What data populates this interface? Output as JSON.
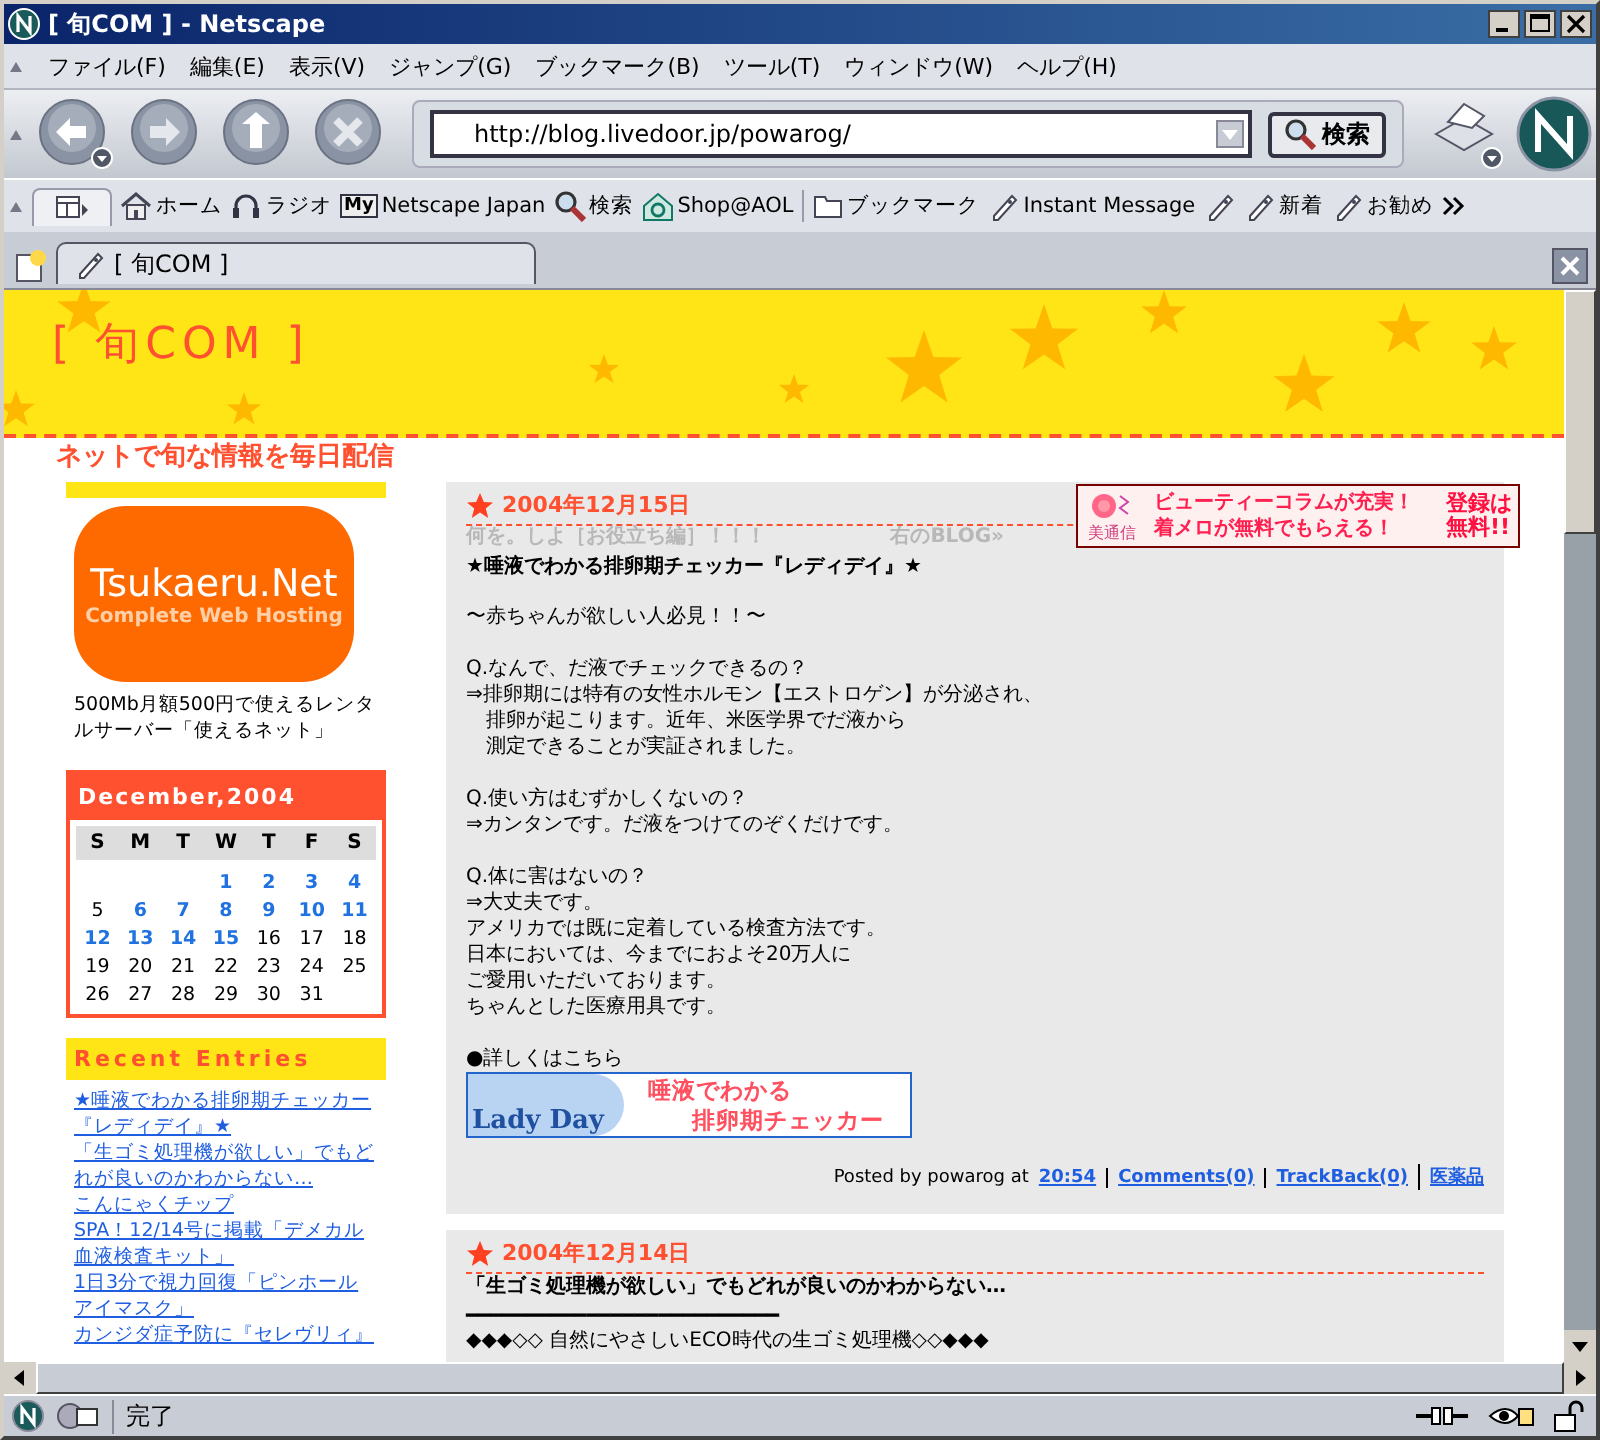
{
  "window": {
    "title": "[ 旬COM ] - Netscape"
  },
  "menu": [
    "ファイル(F)",
    "編集(E)",
    "表示(V)",
    "ジャンプ(G)",
    "ブックマーク(B)",
    "ツール(T)",
    "ウィンドウ(W)",
    "ヘルプ(H)"
  ],
  "address": {
    "value": "http://blog.livedoor.jp/powarog/",
    "search_button": "検索"
  },
  "personal_toolbar": [
    {
      "kind": "home",
      "label": "ホーム"
    },
    {
      "kind": "radio",
      "label": "ラジオ"
    },
    {
      "kind": "my",
      "badge": "My",
      "label": "Netscape Japan"
    },
    {
      "kind": "search",
      "label": "検索"
    },
    {
      "kind": "shop",
      "label": "Shop@AOL"
    },
    {
      "kind": "folder",
      "label": "ブックマーク"
    },
    {
      "kind": "bookmark",
      "label": "Instant Message"
    },
    {
      "kind": "bookmark"
    },
    {
      "kind": "bookmark",
      "label": "新着"
    },
    {
      "kind": "bookmark",
      "label": "お勧め"
    }
  ],
  "tab": {
    "title": "[ 旬COM ]"
  },
  "blog": {
    "title": "[ 旬COM ]",
    "tagline": "ネットで旬な情報を毎日配信"
  },
  "sidebar": {
    "ad": {
      "logo": "Tsukaeru.Net",
      "logo_tagline": "Complete Web Hosting",
      "caption": "500Mb月額500円で使えるレンタルサーバー「使えるネット」"
    },
    "calendar": {
      "title": "December,2004",
      "weekdays": [
        "S",
        "M",
        "T",
        "W",
        "T",
        "F",
        "S"
      ],
      "weeks": [
        [
          {
            "day": "1",
            "linked": true
          },
          {
            "day": "2",
            "linked": true
          },
          {
            "day": "3",
            "linked": true
          },
          {
            "day": "4",
            "linked": true
          }
        ],
        [
          {
            "day": "5",
            "linked": false
          },
          {
            "day": "6",
            "linked": true
          },
          {
            "day": "7",
            "linked": true
          },
          {
            "day": "8",
            "linked": true
          },
          {
            "day": "9",
            "linked": true
          },
          {
            "day": "10",
            "linked": true
          },
          {
            "day": "11",
            "linked": true
          }
        ],
        [
          {
            "day": "12",
            "linked": true
          },
          {
            "day": "13",
            "linked": true
          },
          {
            "day": "14",
            "linked": true
          },
          {
            "day": "15",
            "linked": true
          },
          {
            "day": "16",
            "linked": false
          },
          {
            "day": "17",
            "linked": false
          },
          {
            "day": "18",
            "linked": false
          }
        ],
        [
          {
            "day": "19",
            "linked": false
          },
          {
            "day": "20",
            "linked": false
          },
          {
            "day": "21",
            "linked": false
          },
          {
            "day": "22",
            "linked": false
          },
          {
            "day": "23",
            "linked": false
          },
          {
            "day": "24",
            "linked": false
          },
          {
            "day": "25",
            "linked": false
          }
        ],
        [
          {
            "day": "26",
            "linked": false
          },
          {
            "day": "27",
            "linked": false
          },
          {
            "day": "28",
            "linked": false
          },
          {
            "day": "29",
            "linked": false
          },
          {
            "day": "30",
            "linked": false
          },
          {
            "day": "31",
            "linked": false
          }
        ]
      ]
    },
    "recent_entries": {
      "title": "Recent Entries",
      "items": [
        "★唾液でわかる排卵期チェッカー『レディデイ』★",
        "「生ゴミ処理機が欲しい」でもどれが良いのかわからない…",
        "こんにゃくチップ",
        "SPA！12/14号に掲載「デメカル血液検査キット」",
        "1日3分で視力回復「ピンホールアイマスク」",
        "カンジダ症予防に『セレヴリィ』"
      ]
    }
  },
  "ad_banner": {
    "brand": "美通信",
    "line_1": "ビューティーコラムが充実！",
    "line_2": "着メロが無料でもらえる！",
    "badge_1": "登録は",
    "badge_2": "無料!!"
  },
  "posts": [
    {
      "date": "2004年12月15日",
      "ticker_left": "何を。しよ［お役立ち編］！！！",
      "ticker_right": "右のBLOG»",
      "title": "★唾液でわかる排卵期チェッカー『レディデイ』★",
      "paragraphs": [
        [
          "〜赤ちゃんが欲しい人必見！！〜"
        ],
        [
          "Q.なんで、だ液でチェックできるの？",
          "⇒排卵期には特有の女性ホルモン【エストロゲン】が分泌され、",
          "　排卵が起こります。近年、米医学界でだ液から",
          "　測定できることが実証されました。"
        ],
        [
          "Q.使い方はむずかしくないの？",
          "⇒カンタンです。だ液をつけてのぞくだけです。"
        ],
        [
          "Q.体に害はないの？",
          "⇒大丈夫です。",
          "アメリカでは既に定着している検査方法です。",
          "日本においては、今までにおよそ20万人に",
          "ご愛用いただいております。",
          "ちゃんとした医療用具です。"
        ],
        [
          "●詳しくはこちら"
        ]
      ],
      "banner": {
        "brand": "Lady Day",
        "line_1": "唾液でわかる",
        "line_2": "排卵期チェッカー"
      },
      "footer": {
        "posted_by": "Posted by powarog at",
        "time": "20:54",
        "comments": "Comments(0)",
        "trackback": "TrackBack(0)",
        "category": "医薬品"
      }
    },
    {
      "date": "2004年12月14日",
      "title": "「生ゴミ処理機が欲しい」でもどれが良いのかわからない…",
      "paragraphs": [
        [
          "━━━━━━━━━━━━━━━━━━━━━━━━━━",
          "◆◆◆◇◇ 自然にやさしいECO時代の生ゴミ処理機◇◇◆◆◆"
        ]
      ]
    }
  ],
  "status_bar": {
    "text": "完了"
  }
}
